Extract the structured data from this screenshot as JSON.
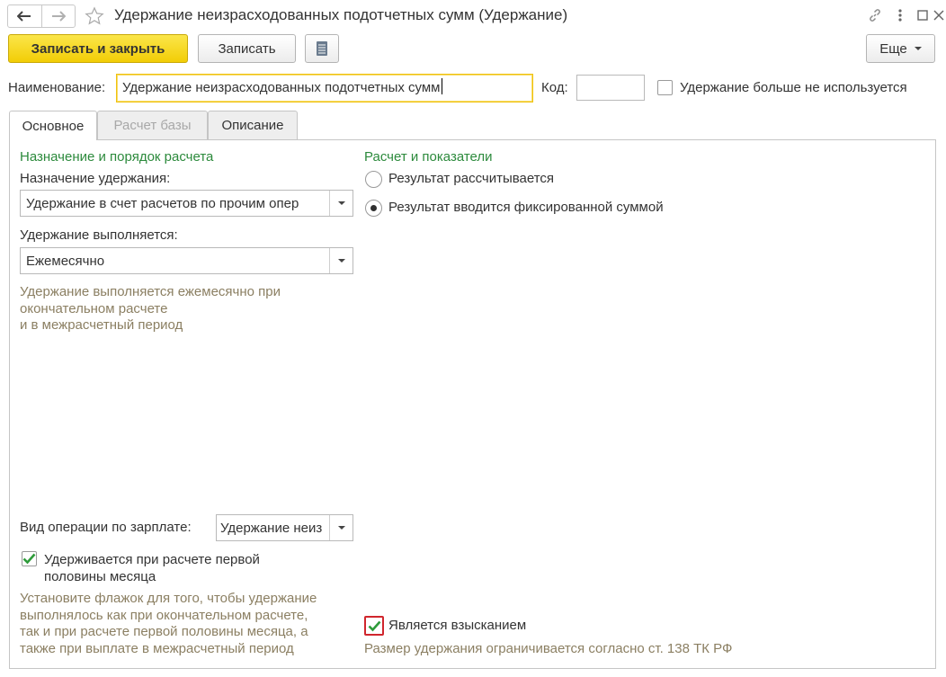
{
  "window": {
    "title": "Удержание неизрасходованных подотчетных сумм (Удержание)",
    "icons": [
      "back-arrow-icon",
      "forward-arrow-icon",
      "star-icon",
      "link-icon",
      "more-vertical-icon",
      "restore-icon",
      "close-icon"
    ]
  },
  "toolbar": {
    "save_close": "Записать и закрыть",
    "save": "Записать",
    "more": "Еще"
  },
  "header": {
    "name_label": "Наименование:",
    "name_value": "Удержание неизрасходованных подотчетных сумм",
    "code_label": "Код:",
    "code_value": "",
    "not_used_label": "Удержание больше не используется",
    "not_used_checked": false
  },
  "tabs": [
    {
      "label": "Основное",
      "active": true
    },
    {
      "label": "Расчет базы",
      "disabled": true
    },
    {
      "label": "Описание"
    }
  ],
  "left": {
    "group_title": "Назначение и порядок расчета",
    "purpose_label": "Назначение удержания:",
    "purpose_value": "Удержание в счет расчетов по прочим опер",
    "schedule_label": "Удержание выполняется:",
    "schedule_value": "Ежемесячно",
    "schedule_hint": [
      "Удержание выполняется ежемесячно при",
      "окончательном расчете",
      "и в межрасчетный период"
    ],
    "operation_label": "Вид операции по зарплате:",
    "operation_value": "Удержание неиз",
    "first_half_label": [
      "Удерживается при расчете первой",
      "половины месяца"
    ],
    "first_half_checked": true,
    "first_half_hint": [
      "Установите флажок для того, чтобы удержание",
      "выполнялось как при окончательном расчете,",
      "так и при расчете первой половины месяца, а",
      "также при выплате в межрасчетный период"
    ]
  },
  "right": {
    "group_title": "Расчет и показатели",
    "options": [
      {
        "label": "Результат рассчитывается",
        "selected": false
      },
      {
        "label": "Результат вводится фиксированной суммой",
        "selected": true
      }
    ],
    "recovery_label": "Является взысканием",
    "recovery_checked": true,
    "recovery_hint": "Размер удержания ограничивается согласно ст. 138 ТК РФ"
  },
  "colors": {
    "accent_yellow": "#f5d21c",
    "group_green": "#2c8a3c",
    "hint_brown": "#8b7f62",
    "check_green": "#2e9b3a",
    "highlight_red": "#d0262d"
  }
}
